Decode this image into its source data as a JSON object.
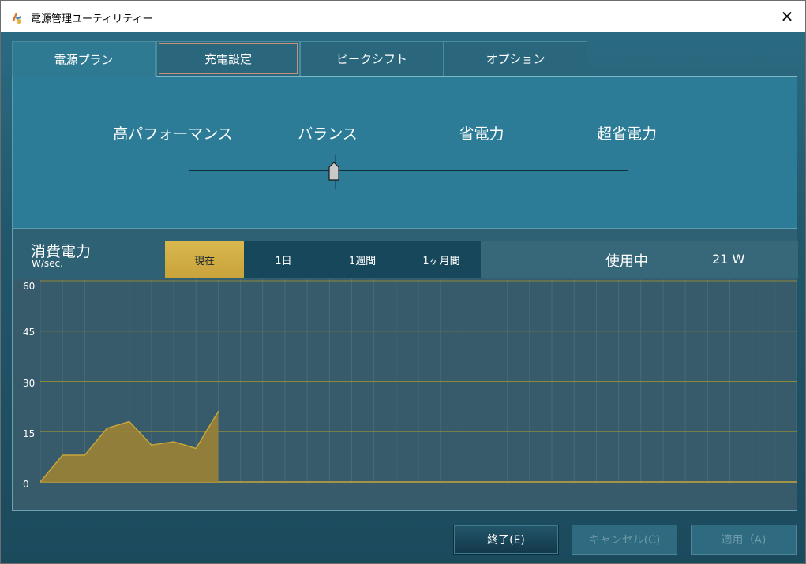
{
  "window": {
    "title": "電源管理ユーティリティー",
    "close_glyph": "✕"
  },
  "tabs": [
    {
      "label": "電源プラン",
      "active": true
    },
    {
      "label": "充電設定",
      "active": false
    },
    {
      "label": "ピークシフト",
      "active": false
    },
    {
      "label": "オプション",
      "active": false
    }
  ],
  "plans": {
    "labels": [
      "高パフォーマンス",
      "バランス",
      "省電力",
      "超省電力"
    ],
    "selected_index": 1
  },
  "power": {
    "title": "消費電力",
    "unit": "W/sec.",
    "periods": [
      {
        "label": "現在",
        "active": true
      },
      {
        "label": "1日",
        "active": false
      },
      {
        "label": "1週間",
        "active": false
      },
      {
        "label": "1ヶ月間",
        "active": false
      }
    ],
    "usage_label": "使用中",
    "usage_value": "21 W"
  },
  "chart_data": {
    "type": "area",
    "y_ticks": [
      "60",
      "45",
      "30",
      "15",
      "0"
    ],
    "ylim": [
      0,
      60
    ],
    "x": [
      0,
      1,
      2,
      3,
      4,
      5,
      6,
      7,
      8
    ],
    "values": [
      0,
      8,
      8,
      16,
      18,
      11,
      12,
      10,
      21
    ],
    "x_slots": 34,
    "grid": true,
    "colors": {
      "fill": "#9a8235",
      "line": "#c8a53a",
      "grid_h": "#8c8a3a",
      "grid_v": "#4b6a77",
      "bg": "#375b6a"
    }
  },
  "buttons": {
    "exit": "終了(E)",
    "cancel": "キャンセル(C)",
    "apply": "適用（A)"
  },
  "icons": {
    "app": "app-icon",
    "close": "close-icon",
    "slider": "slider-thumb-icon"
  }
}
